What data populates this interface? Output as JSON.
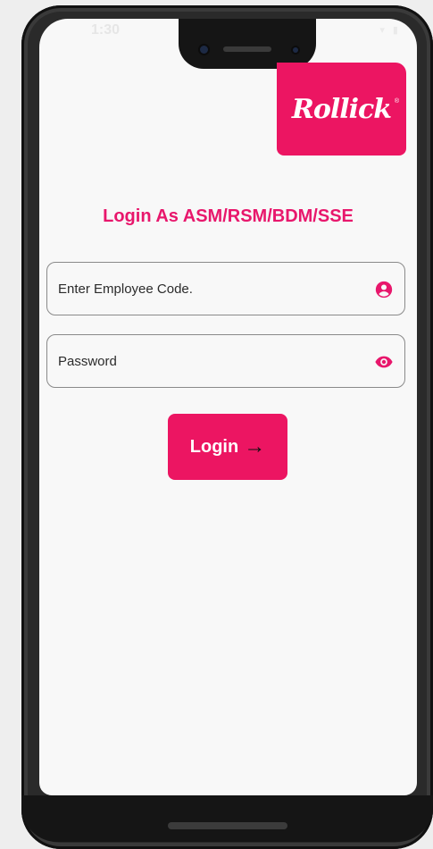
{
  "status_bar": {
    "time": "1:30",
    "icons": "▾ ▮"
  },
  "brand": {
    "logo_text": "Rollick",
    "reg_mark": "®"
  },
  "login": {
    "title": "Login As ASM/RSM/BDM/SSE",
    "employee_code_placeholder": "Enter Employee Code.",
    "employee_code_value": "",
    "password_placeholder": "Password",
    "password_value": "",
    "button_label": "Login",
    "button_arrow": "→"
  },
  "icons": {
    "employee": "account-circle-icon",
    "password": "eye-icon",
    "arrow": "arrow-right-icon"
  },
  "colors": {
    "accent": "#ec1562",
    "title": "#e8176c",
    "background": "#f8f8f8"
  }
}
